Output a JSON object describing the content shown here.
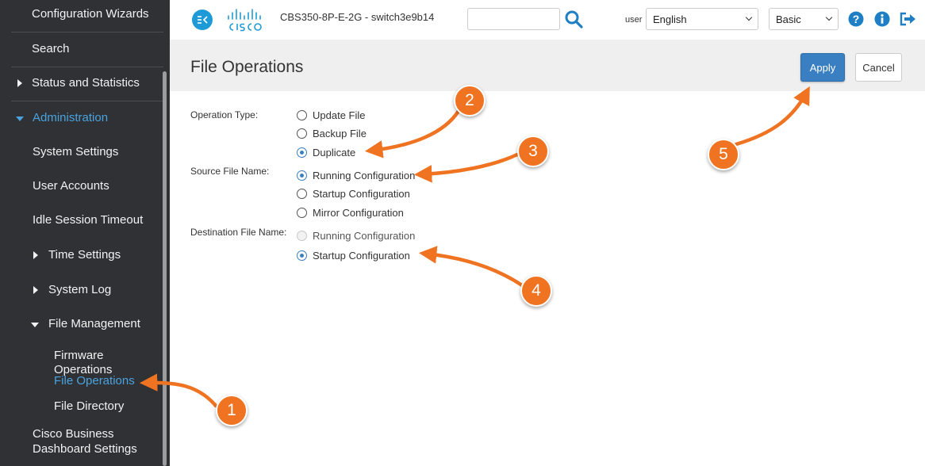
{
  "sidebar": {
    "configuration_wizards": "Configuration Wizards",
    "search": "Search",
    "status_and_statistics": "Status and Statistics",
    "administration": "Administration",
    "system_settings": "System Settings",
    "user_accounts": "User Accounts",
    "idle_session_timeout": "Idle Session Timeout",
    "time_settings": "Time Settings",
    "system_log": "System Log",
    "file_management": "File Management",
    "firmware_operations": "Firmware Operations",
    "file_operations": "File Operations",
    "file_directory": "File Directory",
    "cisco_business_dashboard_line1": "Cisco Business",
    "cisco_business_dashboard_line2": "Dashboard Settings"
  },
  "topbar": {
    "model": "CBS350-8P-E-2G - switch3e9b14",
    "search_value": "",
    "user_label": "user",
    "language": "English",
    "mode": "Basic"
  },
  "page": {
    "title": "File Operations",
    "apply_label": "Apply",
    "cancel_label": "Cancel"
  },
  "form": {
    "operation_type_label": "Operation Type:",
    "operation_options": [
      "Update File",
      "Backup File",
      "Duplicate"
    ],
    "operation_selected": "Duplicate",
    "source_label": "Source File Name:",
    "source_options": [
      "Running Configuration",
      "Startup Configuration",
      "Mirror Configuration"
    ],
    "source_selected": "Running Configuration",
    "destination_label": "Destination File Name:",
    "destination_options": [
      "Running Configuration",
      "Startup Configuration"
    ],
    "destination_selected": "Startup Configuration",
    "destination_disabled": "Running Configuration"
  },
  "annotations": [
    "1",
    "2",
    "3",
    "4",
    "5"
  ],
  "colors": {
    "sidebar_bg": "#2f3135",
    "active_blue": "#4aa3df",
    "apply_blue": "#3a7fc1",
    "callout_orange": "#ef7320",
    "header_bg": "#efeff0"
  },
  "icons": {
    "collapse": "collapse-menu-icon",
    "logo": "cisco-logo-icon",
    "search": "search-icon",
    "help": "help-icon",
    "info": "info-icon",
    "logout": "logout-icon"
  }
}
